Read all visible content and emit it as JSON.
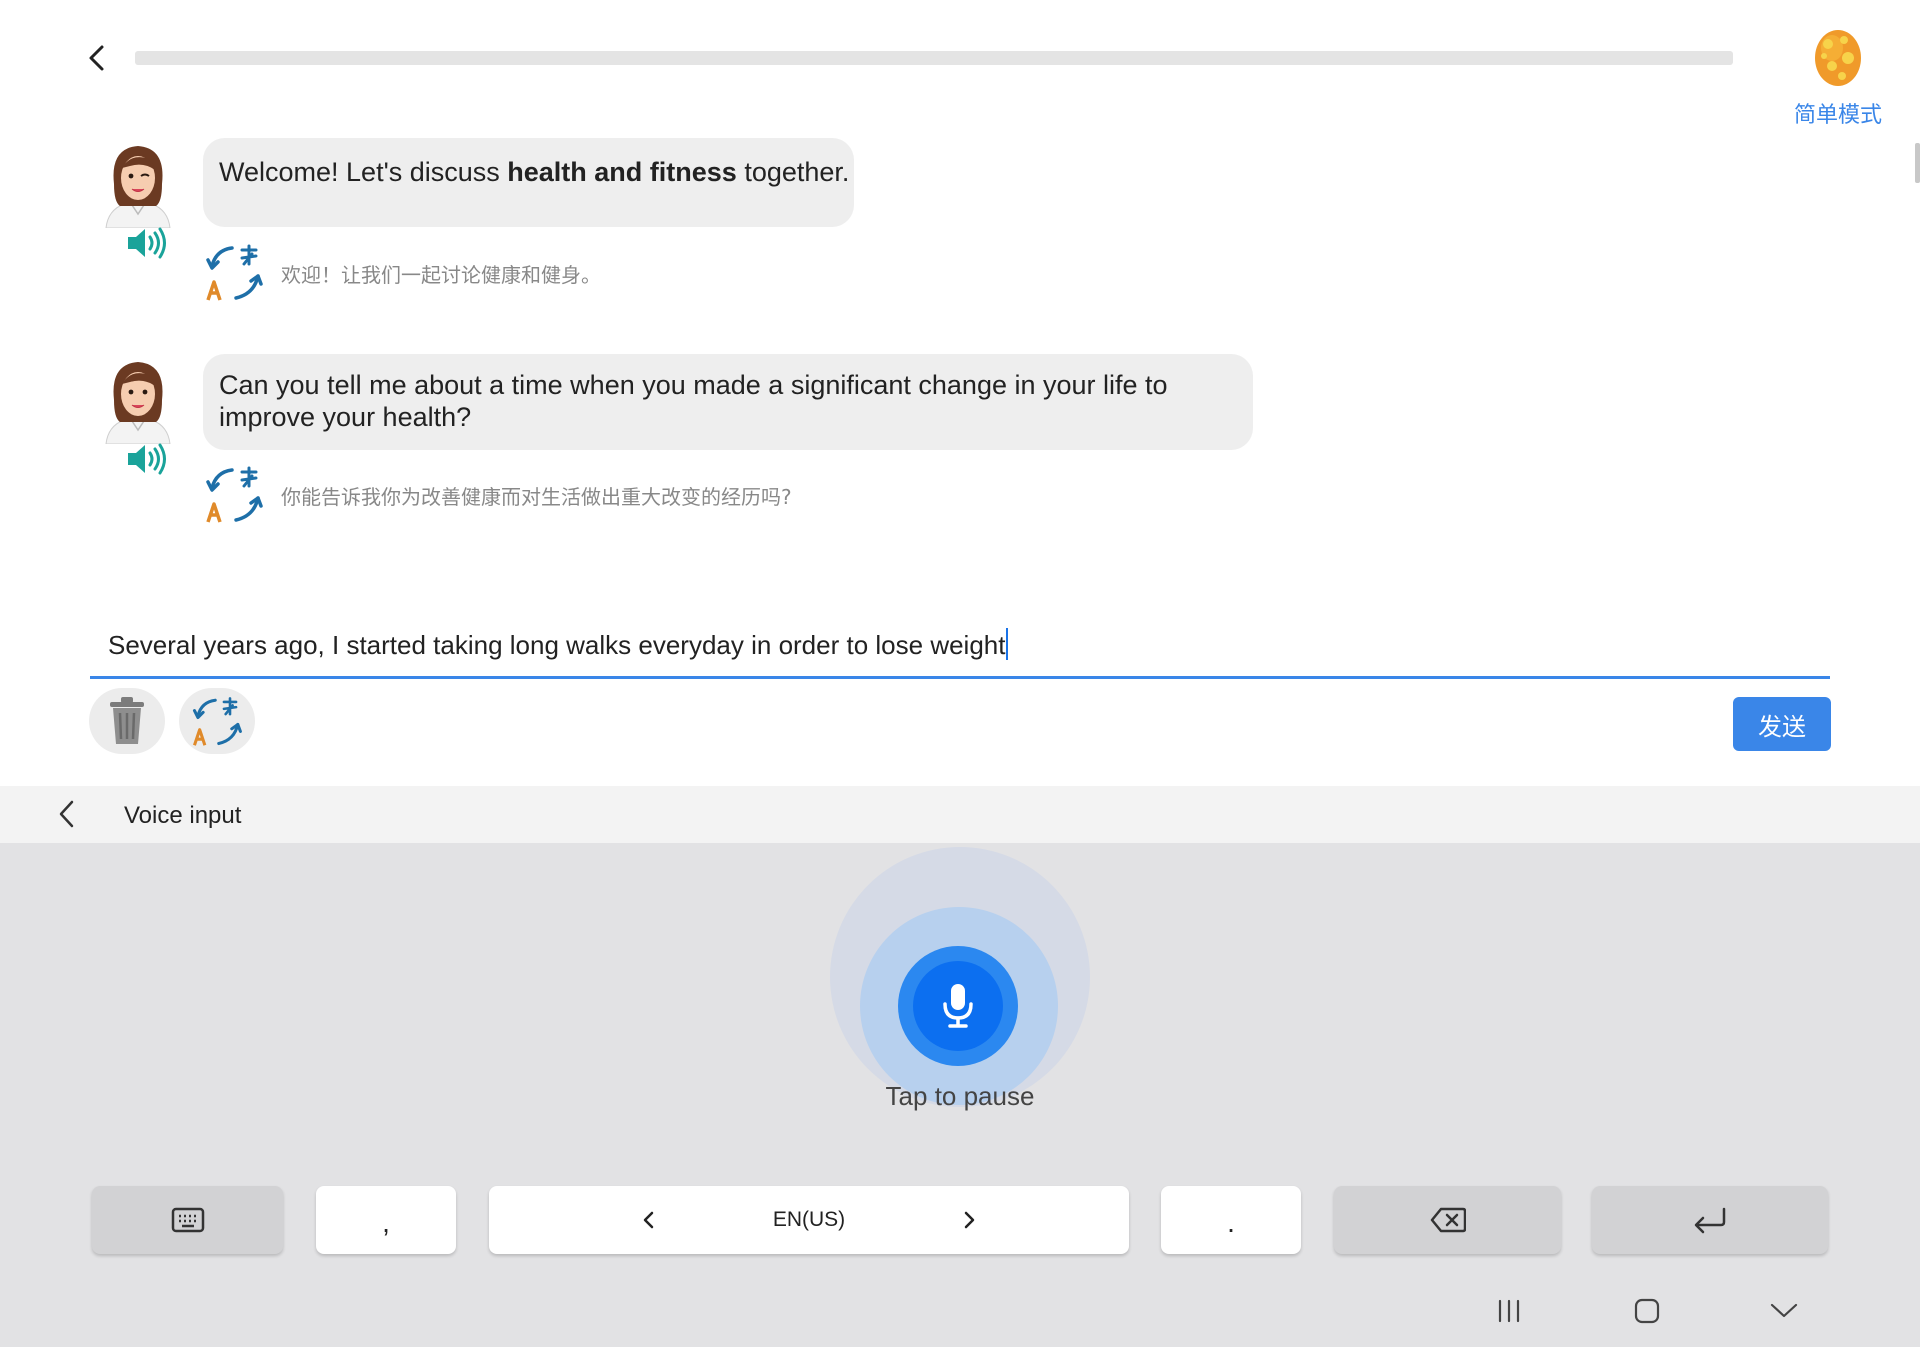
{
  "header": {
    "progress_fraction": 0.0,
    "mode_label": "简单模式",
    "icons": {
      "back": "chevron-left-icon",
      "mode": "egg-icon"
    }
  },
  "messages": [
    {
      "sender": "assistant",
      "text_before": "Welcome! Let's discuss ",
      "text_bold": "health and fitness",
      "text_after": " together.",
      "translation": "欢迎！让我们一起讨论健康和健身。"
    },
    {
      "sender": "assistant",
      "text_line1": "Can you tell me about a time when you made a significant change in your life to",
      "text_line2": "improve your health?",
      "translation": "你能告诉我你为改善健康而对生活做出重大改变的经历吗?"
    }
  ],
  "composer": {
    "input_value": "Several years ago, I started taking long walks everyday in order to lose weight",
    "send_label": "发送",
    "icons": {
      "delete": "trash-icon",
      "translate": "translate-icon"
    }
  },
  "voice_input": {
    "title": "Voice input",
    "status": "Tap to pause",
    "icons": {
      "back": "chevron-left-icon",
      "mic": "microphone-icon"
    }
  },
  "keyboard": {
    "comma": ",",
    "language": "EN(US)",
    "period": ".",
    "icons": [
      "keyboard-icon",
      "chevron-left-icon",
      "chevron-right-icon",
      "backspace-icon",
      "enter-icon"
    ]
  },
  "navbar": {
    "icons": [
      "recent-apps-icon",
      "home-icon",
      "hide-keyboard-icon"
    ]
  },
  "colors": {
    "accent": "#3a86e8",
    "mic": "#0c6ff0",
    "bubble": "#eeeeee",
    "speaker": "#1aa39a",
    "translate_blue": "#1e6fa8",
    "translate_orange": "#e08a2a"
  }
}
